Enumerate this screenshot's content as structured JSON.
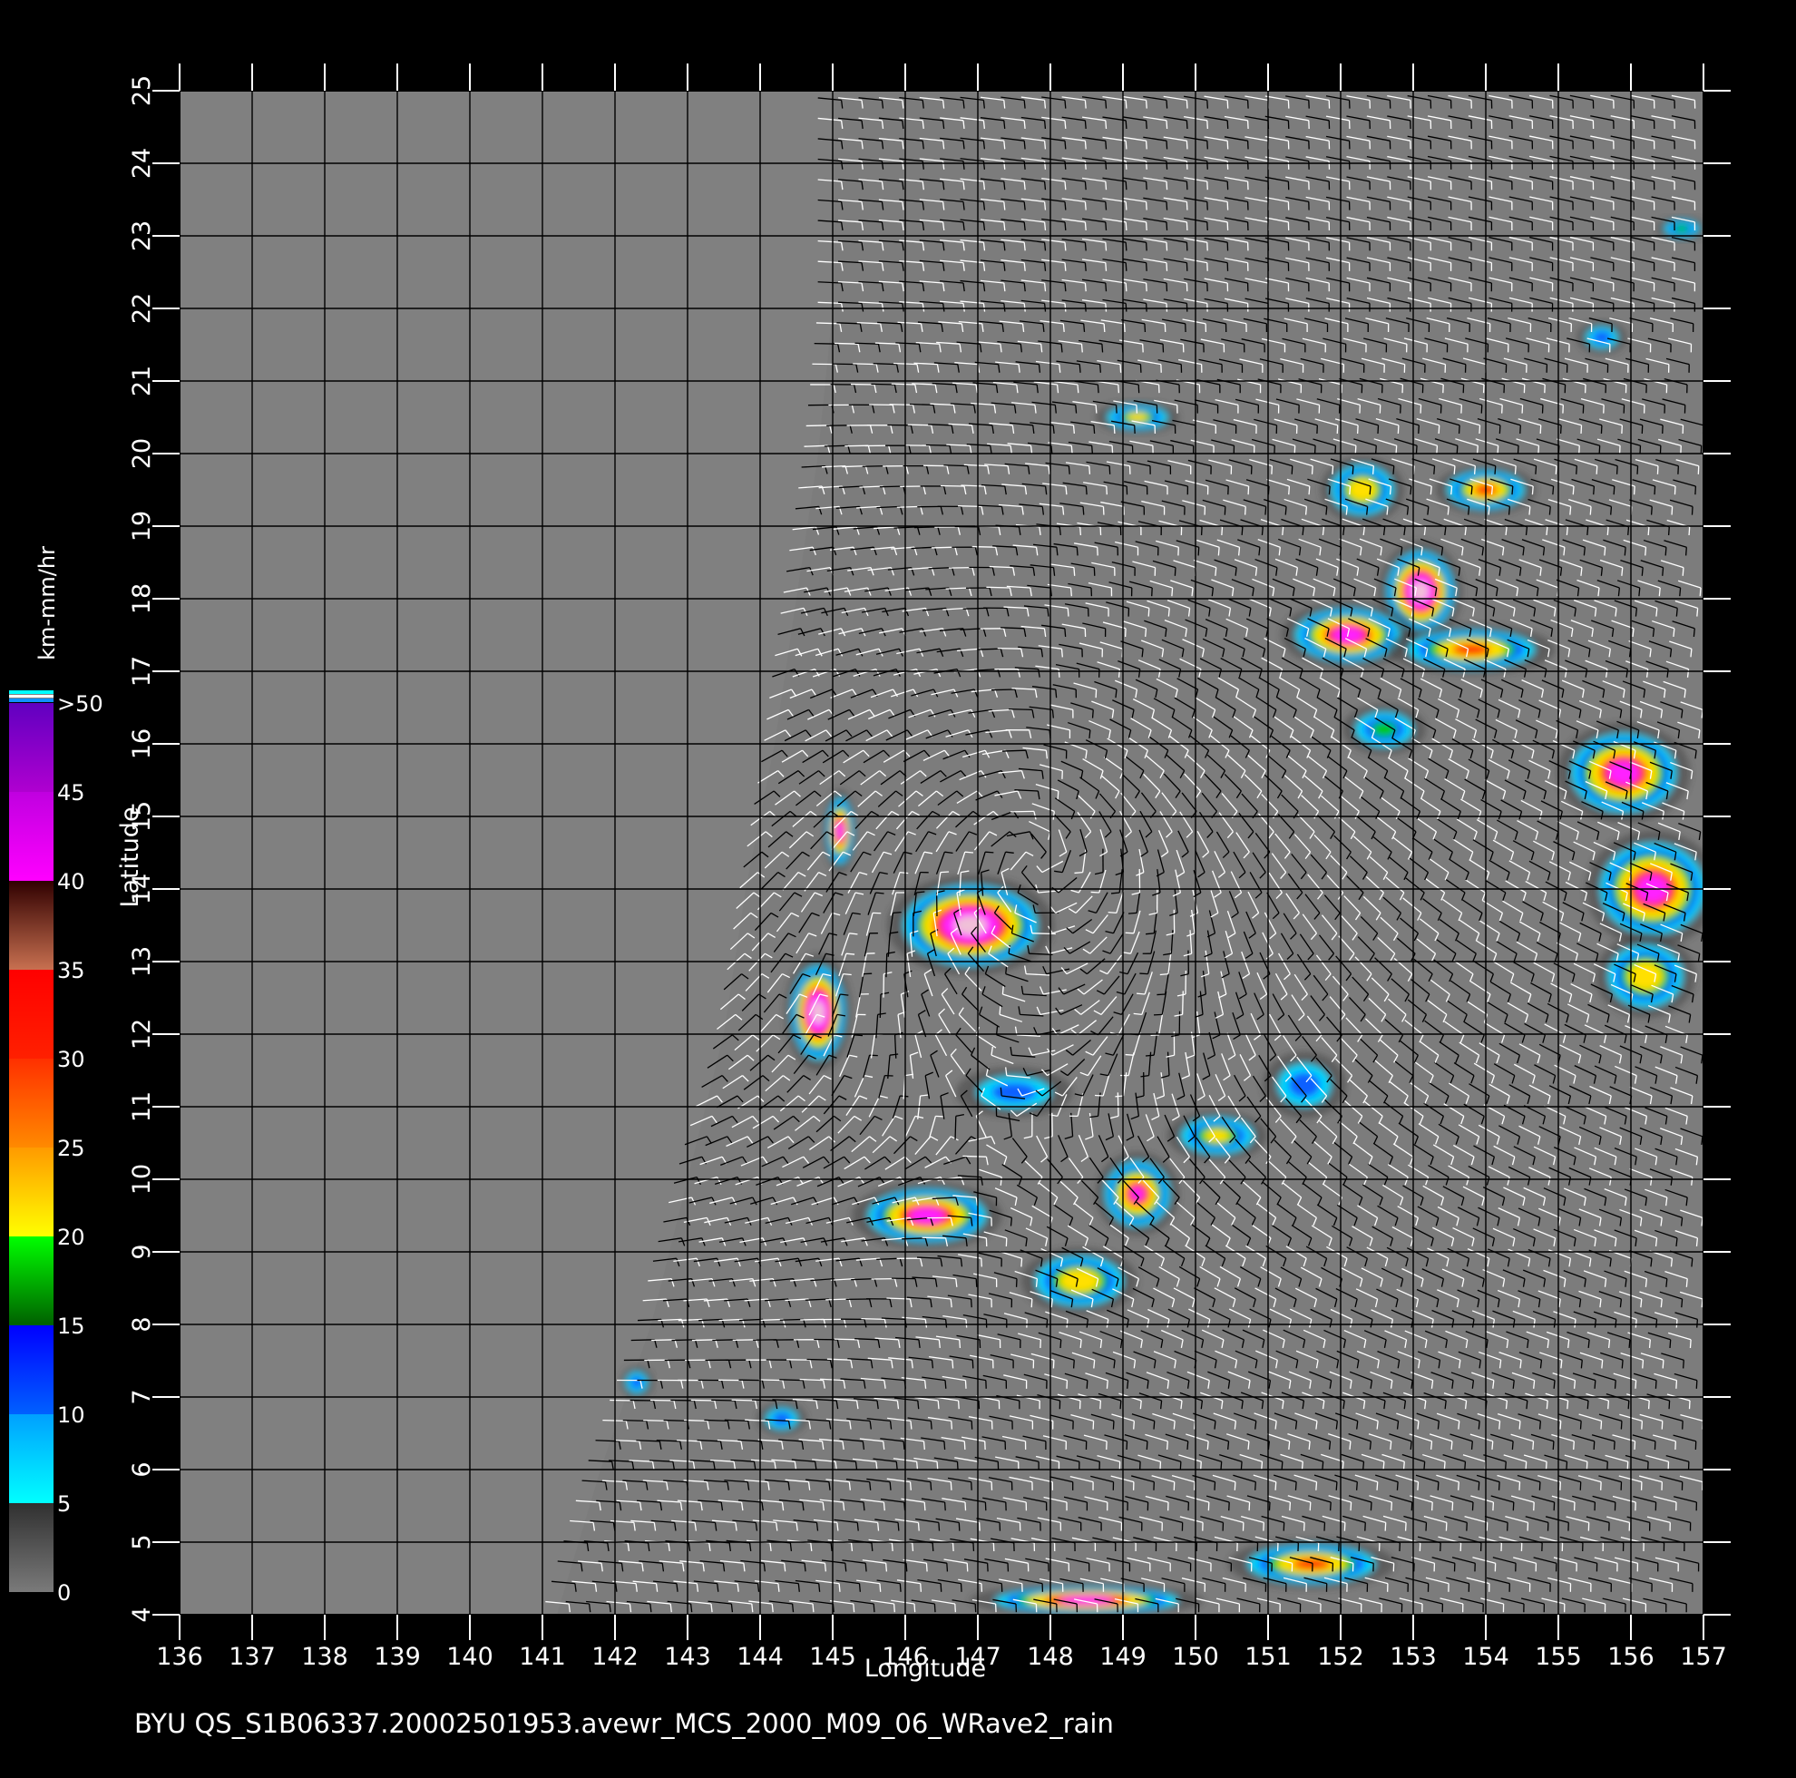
{
  "map": {
    "x_axis": {
      "label": "Longitude",
      "min": 136,
      "max": 157,
      "ticks": [
        "136",
        "137",
        "138",
        "139",
        "140",
        "141",
        "142",
        "143",
        "144",
        "145",
        "146",
        "147",
        "148",
        "149",
        "150",
        "151",
        "152",
        "153",
        "154",
        "155",
        "156",
        "157"
      ]
    },
    "y_axis": {
      "label": "Latitude",
      "min": 4,
      "max": 25,
      "ticks": [
        "4",
        "5",
        "6",
        "7",
        "8",
        "9",
        "10",
        "11",
        "12",
        "13",
        "14",
        "15",
        "16",
        "17",
        "18",
        "19",
        "20",
        "21",
        "22",
        "23",
        "24",
        "25"
      ]
    },
    "grid": true,
    "no_data_color": "#808080",
    "swath_west_edge_lon_by_lat": [
      [
        4,
        141.2
      ],
      [
        6,
        141.8
      ],
      [
        8,
        142.5
      ],
      [
        10,
        143.0
      ],
      [
        12,
        143.5
      ],
      [
        14,
        143.8
      ],
      [
        16,
        144.2
      ],
      [
        18,
        144.5
      ],
      [
        20,
        144.8
      ],
      [
        22,
        145.0
      ],
      [
        25,
        145.0
      ]
    ],
    "wind_vector_colors": [
      "#ffffff",
      "#000000"
    ],
    "cyclone_center": {
      "lon": 147.8,
      "lat": 14.4
    },
    "rain_cells": [
      {
        "lon": 146.9,
        "lat": 13.5,
        "rx": 1.0,
        "ry": 0.6,
        "max": 50
      },
      {
        "lon": 144.8,
        "lat": 12.3,
        "rx": 0.4,
        "ry": 0.7,
        "max": 50
      },
      {
        "lon": 145.1,
        "lat": 14.8,
        "rx": 0.2,
        "ry": 0.5,
        "max": 40
      },
      {
        "lon": 146.3,
        "lat": 9.5,
        "rx": 0.9,
        "ry": 0.4,
        "max": 40
      },
      {
        "lon": 149.2,
        "lat": 9.8,
        "rx": 0.5,
        "ry": 0.5,
        "max": 35
      },
      {
        "lon": 150.3,
        "lat": 10.6,
        "rx": 0.6,
        "ry": 0.3,
        "max": 20
      },
      {
        "lon": 148.4,
        "lat": 8.6,
        "rx": 0.7,
        "ry": 0.4,
        "max": 25
      },
      {
        "lon": 148.5,
        "lat": 4.2,
        "rx": 1.4,
        "ry": 0.2,
        "max": 40
      },
      {
        "lon": 151.6,
        "lat": 4.7,
        "rx": 1.0,
        "ry": 0.3,
        "max": 30
      },
      {
        "lon": 153.1,
        "lat": 18.1,
        "rx": 0.5,
        "ry": 0.6,
        "max": 50
      },
      {
        "lon": 152.1,
        "lat": 17.5,
        "rx": 0.8,
        "ry": 0.4,
        "max": 40
      },
      {
        "lon": 153.8,
        "lat": 17.3,
        "rx": 1.0,
        "ry": 0.3,
        "max": 30
      },
      {
        "lon": 155.9,
        "lat": 15.6,
        "rx": 0.8,
        "ry": 0.6,
        "max": 40
      },
      {
        "lon": 156.3,
        "lat": 14.0,
        "rx": 0.8,
        "ry": 0.7,
        "max": 40
      },
      {
        "lon": 156.2,
        "lat": 12.8,
        "rx": 0.6,
        "ry": 0.5,
        "max": 25
      },
      {
        "lon": 152.3,
        "lat": 19.5,
        "rx": 0.5,
        "ry": 0.4,
        "max": 25
      },
      {
        "lon": 154.0,
        "lat": 19.5,
        "rx": 0.6,
        "ry": 0.3,
        "max": 30
      },
      {
        "lon": 149.2,
        "lat": 20.5,
        "rx": 0.5,
        "ry": 0.2,
        "max": 20
      },
      {
        "lon": 152.6,
        "lat": 16.2,
        "rx": 0.5,
        "ry": 0.3,
        "max": 15
      },
      {
        "lon": 144.3,
        "lat": 6.7,
        "rx": 0.3,
        "ry": 0.2,
        "max": 10
      },
      {
        "lon": 142.3,
        "lat": 7.2,
        "rx": 0.2,
        "ry": 0.2,
        "max": 10
      },
      {
        "lon": 155.6,
        "lat": 21.6,
        "rx": 0.3,
        "ry": 0.2,
        "max": 10
      },
      {
        "lon": 156.7,
        "lat": 23.1,
        "rx": 0.3,
        "ry": 0.15,
        "max": 15
      },
      {
        "lon": 151.5,
        "lat": 11.3,
        "rx": 0.5,
        "ry": 0.4,
        "max": 10
      },
      {
        "lon": 147.5,
        "lat": 11.2,
        "rx": 0.7,
        "ry": 0.3,
        "max": 10
      }
    ]
  },
  "colorbar": {
    "unit_label": "km-mm/hr",
    "tick_labels": [
      "0",
      "5",
      "10",
      "15",
      "20",
      "25",
      "30",
      "35",
      "40",
      "45",
      ">50"
    ],
    "segments": [
      {
        "from": 0,
        "to": 5,
        "colors": [
          "#7a7a7a",
          "#303030"
        ]
      },
      {
        "from": 5,
        "to": 10,
        "colors": [
          "#00ffff",
          "#00a0ff"
        ]
      },
      {
        "from": 10,
        "to": 15,
        "colors": [
          "#0060ff",
          "#0000ff"
        ]
      },
      {
        "from": 15,
        "to": 20,
        "colors": [
          "#006000",
          "#00ff00"
        ]
      },
      {
        "from": 20,
        "to": 25,
        "colors": [
          "#ffff00",
          "#ff9a00"
        ]
      },
      {
        "from": 25,
        "to": 30,
        "colors": [
          "#ff8a00",
          "#ff3000"
        ]
      },
      {
        "from": 30,
        "to": 35,
        "colors": [
          "#ff2000",
          "#ff0000"
        ]
      },
      {
        "from": 35,
        "to": 40,
        "colors": [
          "#c87050",
          "#300000"
        ]
      },
      {
        "from": 40,
        "to": 45,
        "colors": [
          "#ff00ff",
          "#c000e0"
        ]
      },
      {
        "from": 45,
        "to": 50,
        "colors": [
          "#b000d0",
          "#6000c0"
        ]
      }
    ],
    "cap_colors": [
      "#00ffff",
      "#ffffff",
      "#1090ff"
    ]
  },
  "footer": "BYU  QS_S1B06337.20002501953.avewr_MCS_2000_M09_06_WRave2_rain"
}
